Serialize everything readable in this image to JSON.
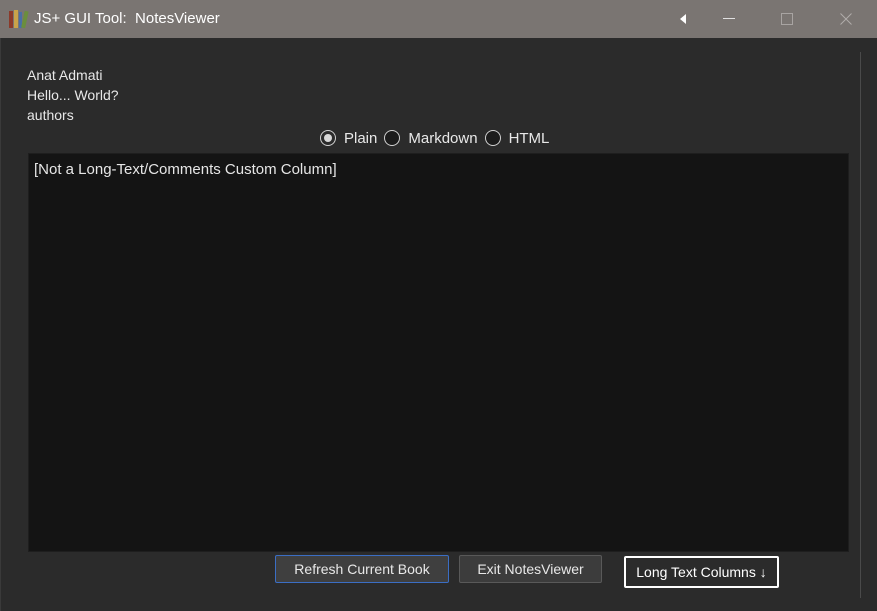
{
  "window": {
    "title": "JS+ GUI Tool:  NotesViewer",
    "back_glyph": "⏴",
    "minimize_glyph": "—",
    "maximize_glyph": "☐",
    "close_glyph": "✕",
    "app_icon": "books-icon"
  },
  "info": {
    "line1": "Anat Admati",
    "line2": "Hello... World?",
    "line3": "authors"
  },
  "format": {
    "options": [
      {
        "label": "Plain",
        "selected": true
      },
      {
        "label": "Markdown",
        "selected": false
      },
      {
        "label": "HTML",
        "selected": false
      }
    ]
  },
  "notes": {
    "content": "[Not a Long-Text/Comments Custom Column]"
  },
  "buttons": {
    "refresh": "Refresh Current Book",
    "exit": "Exit NotesViewer",
    "long_text": "Long Text Columns ↓"
  },
  "colors": {
    "titlebar": "#7a7572",
    "background": "#2b2b2b",
    "notes_bg": "#141414",
    "accent_border": "#3b6ec4"
  }
}
